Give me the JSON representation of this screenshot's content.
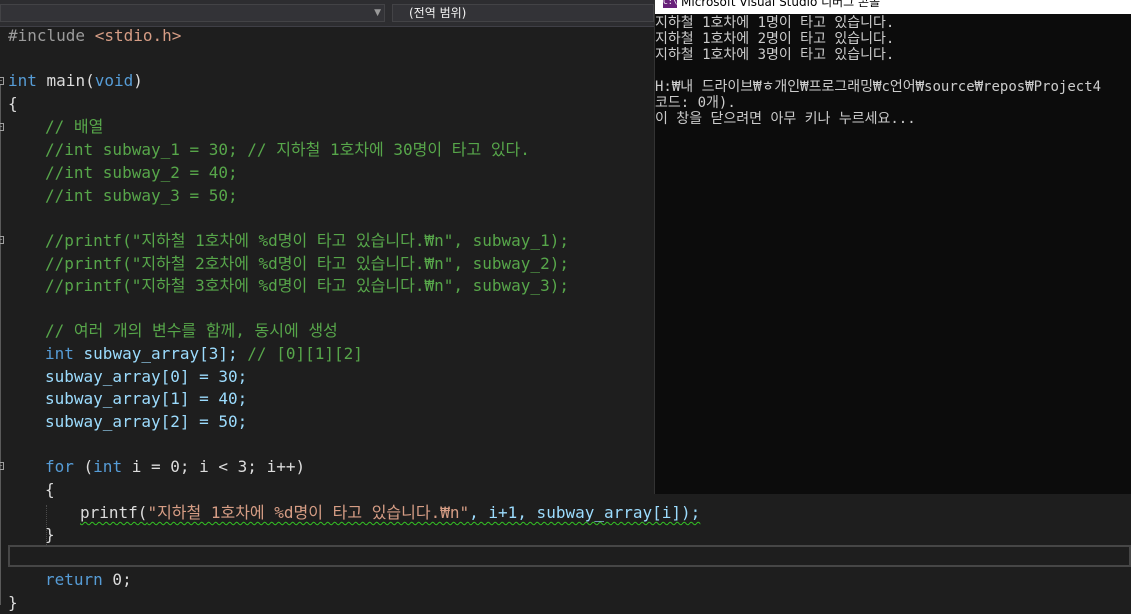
{
  "nav": {
    "left_dropdown": "",
    "right_dropdown": "(전역 범위)"
  },
  "code": {
    "line1": {
      "pp": "#include ",
      "inc": "<stdio.h>"
    },
    "line2": {
      "kw": "int",
      "name": " main(",
      "kw2": "void",
      "end": ")"
    },
    "brace_open": "{",
    "c_array": "// 배열",
    "c1": "//int subway_1 = 30; // 지하철 1호차에 30명이 타고 있다.",
    "c2": "//int subway_2 = 40;",
    "c3": "//int subway_3 = 50;",
    "p1": "//printf(\"지하철 1호차에 %d명이 타고 있습니다.₩n\", subway_1);",
    "p2": "//printf(\"지하철 2호차에 %d명이 타고 있습니다.₩n\", subway_2);",
    "p3": "//printf(\"지하철 3호차에 %d명이 타고 있습니다.₩n\", subway_3);",
    "c_multi": "// 여러 개의 변수를 함께, 동시에 생성",
    "decl": {
      "kw": "int",
      "rest": " subway_array[3]; ",
      "cm": "// [0][1][2]"
    },
    "a0": "subway_array[0] = 30;",
    "a1": "subway_array[1] = 40;",
    "a2": "subway_array[2] = 50;",
    "for": {
      "kw": "for",
      "p1": " (",
      "kw2": "int",
      "p2": " i = 0; i < 3; i++)"
    },
    "inner_open": "{",
    "printf": {
      "fn": "printf(",
      "str": "\"지하철 1호차에 %d명이 타고 있습니다.₩n\"",
      "rest": ", i+1, subway_array[i]);"
    },
    "inner_close": "}",
    "ret": {
      "kw": "return",
      "rest": " 0;"
    },
    "brace_close": "}"
  },
  "console": {
    "title": "Microsoft Visual Studio 디버그 콘솔",
    "lines": [
      "지하철 1호차에 1명이 타고 있습니다.",
      "지하철 1호차에 2명이 타고 있습니다.",
      "지하철 1호차에 3명이 타고 있습니다.",
      "",
      "H:₩내 드라이브₩ㅎ개인₩프로그래밍₩c언어₩source₩repos₩Project4",
      "코드: 0개).",
      "이 창을 닫으려면 아무 키나 누르세요..."
    ]
  }
}
